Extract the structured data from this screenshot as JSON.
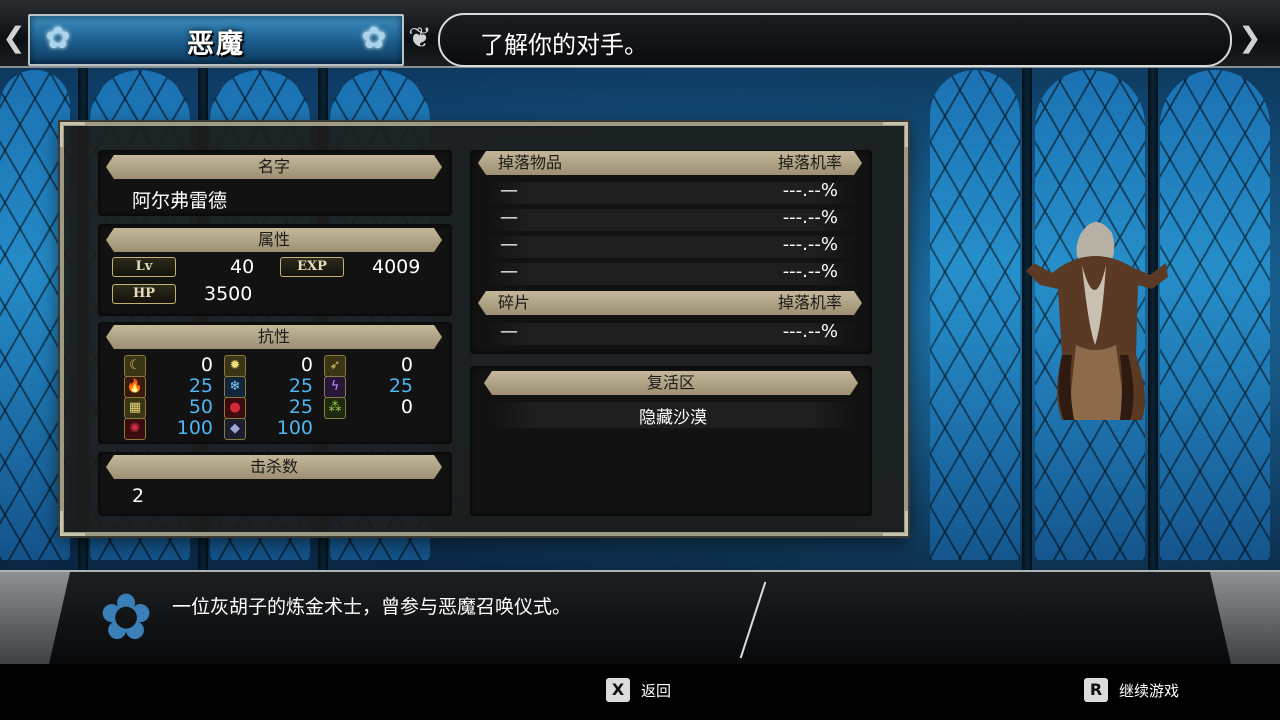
{
  "header": {
    "title": "恶魔",
    "subtitle": "了解你的对手。"
  },
  "name_section": {
    "label": "名字",
    "value": "阿尔弗雷德"
  },
  "attributes": {
    "label": "属性",
    "lv_label": "Lv",
    "lv": "40",
    "exp_label": "EXP",
    "exp": "4009",
    "hp_label": "HP",
    "hp": "3500"
  },
  "resistance": {
    "label": "抗性",
    "rows": [
      [
        {
          "icon": "moon-icon",
          "value": "0",
          "color": "white"
        },
        {
          "icon": "light-icon",
          "value": "0",
          "color": "white"
        },
        {
          "icon": "wind-icon",
          "value": "0",
          "color": "white"
        }
      ],
      [
        {
          "icon": "fire-icon",
          "value": "25",
          "color": "blue"
        },
        {
          "icon": "ice-icon",
          "value": "25",
          "color": "blue"
        },
        {
          "icon": "lightning-icon",
          "value": "25",
          "color": "blue"
        }
      ],
      [
        {
          "icon": "cage-icon",
          "value": "50",
          "color": "blue"
        },
        {
          "icon": "blood-icon",
          "value": "25",
          "color": "blue"
        },
        {
          "icon": "poison-icon",
          "value": "0",
          "color": "white"
        }
      ],
      [
        {
          "icon": "curse-icon",
          "value": "100",
          "color": "blue"
        },
        {
          "icon": "stone-icon",
          "value": "100",
          "color": "blue"
        }
      ]
    ]
  },
  "kills": {
    "label": "击杀数",
    "value": "2"
  },
  "drops": {
    "label": "掉落物品",
    "rate_label": "掉落机率",
    "items": [
      {
        "name": "—",
        "rate": "---.--%"
      },
      {
        "name": "—",
        "rate": "---.--%"
      },
      {
        "name": "—",
        "rate": "---.--%"
      },
      {
        "name": "—",
        "rate": "---.--%"
      }
    ]
  },
  "shards": {
    "label": "碎片",
    "rate_label": "掉落机率",
    "items": [
      {
        "name": "—",
        "rate": "---.--%"
      }
    ]
  },
  "respawn": {
    "label": "复活区",
    "value": "隐藏沙漠"
  },
  "description": "一位灰胡子的炼金术士，曾参与恶魔召唤仪式。",
  "footer": {
    "back_key": "X",
    "back_label": "返回",
    "continue_key": "R",
    "continue_label": "继续游戏"
  },
  "colors": {
    "accent_blue": "#4fb6f2",
    "ribbon": "#b4a888",
    "panel_border": "#9d9a86"
  }
}
